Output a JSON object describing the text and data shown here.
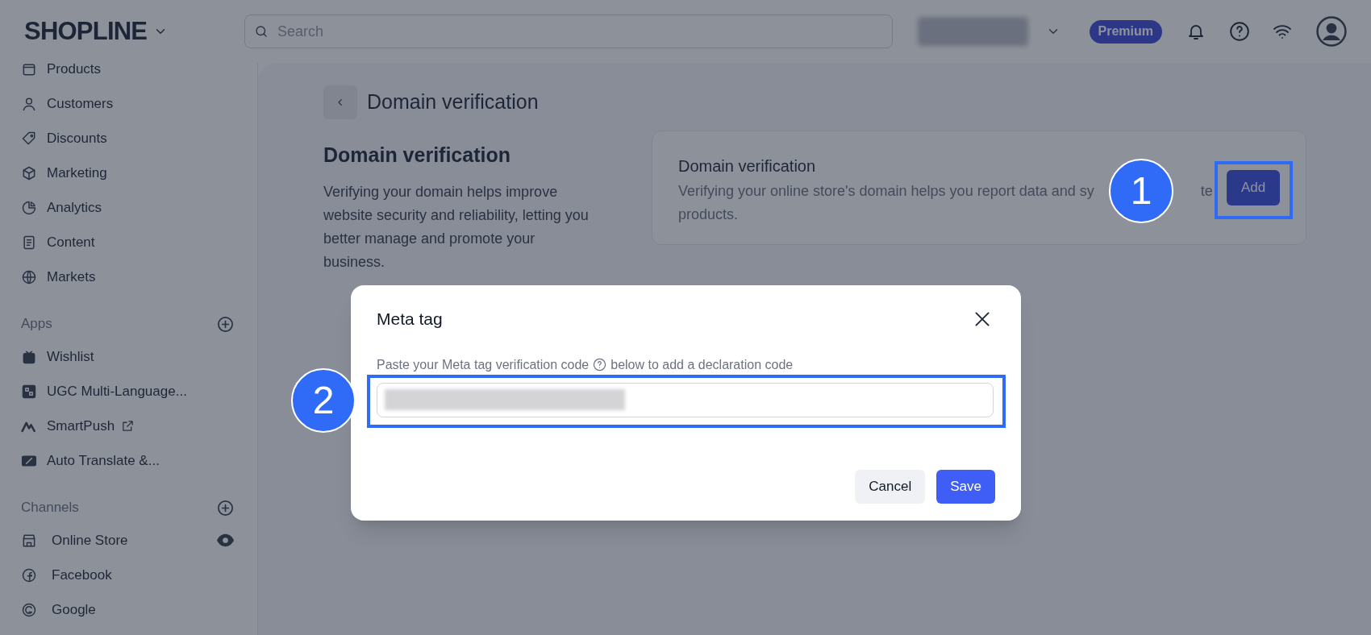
{
  "header": {
    "logo": "SHOPLINE",
    "search": {
      "placeholder": "Search"
    },
    "plan_badge": "Premium"
  },
  "sidebar": {
    "items": [
      {
        "label": "Products"
      },
      {
        "label": "Customers"
      },
      {
        "label": "Discounts"
      },
      {
        "label": "Marketing"
      },
      {
        "label": "Analytics"
      },
      {
        "label": "Content"
      },
      {
        "label": "Markets"
      }
    ],
    "sections": [
      {
        "title": "Apps",
        "items": [
          {
            "label": "Wishlist",
            "external": false
          },
          {
            "label": "UGC Multi-Language...",
            "external": false
          },
          {
            "label": "SmartPush",
            "external": true
          },
          {
            "label": "Auto Translate &...",
            "external": false
          }
        ]
      },
      {
        "title": "Channels",
        "items": [
          {
            "label": "Online Store",
            "preview": true
          },
          {
            "label": "Facebook",
            "preview": false
          },
          {
            "label": "Google",
            "preview": false
          }
        ]
      }
    ]
  },
  "page": {
    "title": "Domain verification",
    "section": {
      "heading": "Domain verification",
      "description": "Verifying your domain helps improve website security and reliability, letting you better manage and promote your business."
    },
    "card": {
      "title": "Domain verification",
      "description": "Verifying your online store's domain helps you report data and sy",
      "description_end": "te",
      "description_line2": "products.",
      "button": "Add"
    }
  },
  "modal": {
    "title": "Meta tag",
    "label_start": "Paste your Meta tag verification code",
    "label_end": "below to add a declaration code",
    "buttons": [
      {
        "label": "Cancel",
        "kind": "secondary"
      },
      {
        "label": "Save",
        "kind": "primary"
      }
    ]
  },
  "annotations": [
    {
      "number": "1"
    },
    {
      "number": "2"
    }
  ]
}
